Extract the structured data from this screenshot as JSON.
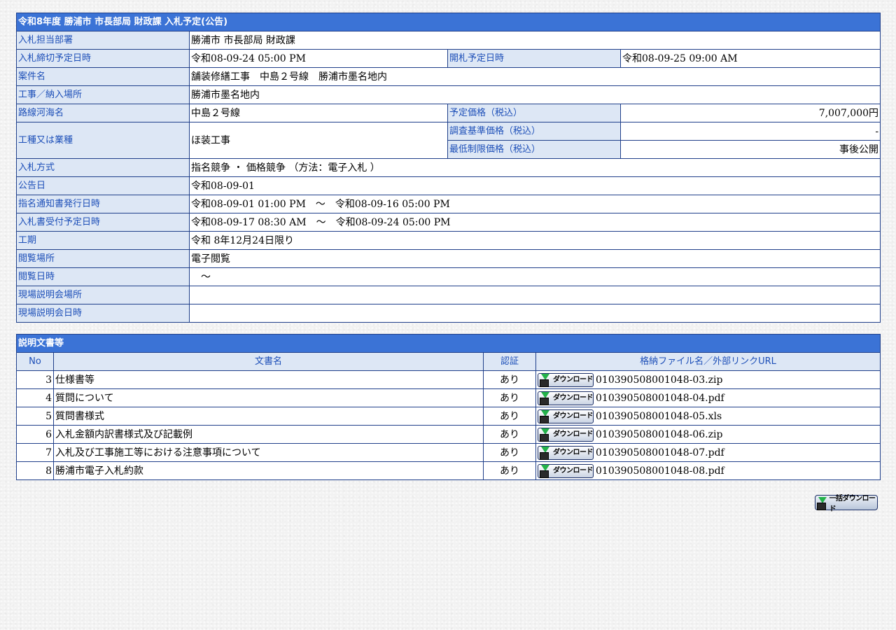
{
  "notice": {
    "title": "令和8年度 勝浦市 市長部局 財政課 入札予定(公告)",
    "rows": {
      "dept": {
        "label": "入札担当部署",
        "value": "勝浦市 市長部局 財政課"
      },
      "deadline": {
        "label": "入札締切予定日時",
        "value": "令和08-09-24 05:00 PM"
      },
      "opening": {
        "label": "開札予定日時",
        "value": "令和08-09-25 09:00 AM"
      },
      "case_name": {
        "label": "案件名",
        "value": "舗装修繕工事　中島２号線　勝浦市墨名地内"
      },
      "place": {
        "label": "工事／納入場所",
        "value": "勝浦市墨名地内"
      },
      "route": {
        "label": "路線河海名",
        "value": "中島２号線"
      },
      "planned_price": {
        "label": "予定価格（税込）",
        "value": "7,007,000円"
      },
      "category": {
        "label": "工種又は業種",
        "value": "ほ装工事"
      },
      "survey_price": {
        "label": "調査基準価格（税込）",
        "value": "-"
      },
      "min_price": {
        "label": "最低制限価格（税込）",
        "value": "事後公開"
      },
      "method": {
        "label": "入札方式",
        "value": "指名競争 ・ 価格競争 （方法：電子入札 ）"
      },
      "notice_date": {
        "label": "公告日",
        "value": "令和08-09-01"
      },
      "nomination": {
        "label": "指名通知書発行日時",
        "value": "令和08-09-01 01:00 PM　～　令和08-09-16 05:00 PM"
      },
      "acceptance": {
        "label": "入札書受付予定日時",
        "value": "令和08-09-17 08:30 AM　～　令和08-09-24 05:00 PM"
      },
      "period": {
        "label": "工期",
        "value": "令和 8年12月24日限り"
      },
      "view_place": {
        "label": "閲覧場所",
        "value": "電子閲覧"
      },
      "view_date": {
        "label": "閲覧日時",
        "value": "　～"
      },
      "briefing_place": {
        "label": "現場説明会場所",
        "value": ""
      },
      "briefing_date": {
        "label": "現場説明会日時",
        "value": ""
      }
    }
  },
  "documents": {
    "title": "説明文書等",
    "headers": {
      "no": "No",
      "name": "文書名",
      "auth": "認証",
      "file": "格納ファイル名／外部リンクURL"
    },
    "download_label": "ダウンロード",
    "items": [
      {
        "no": "3",
        "name": "仕様書等",
        "auth": "あり",
        "file": "010390508001048-03.zip"
      },
      {
        "no": "4",
        "name": "質問について",
        "auth": "あり",
        "file": "010390508001048-04.pdf"
      },
      {
        "no": "5",
        "name": "質問書様式",
        "auth": "あり",
        "file": "010390508001048-05.xls"
      },
      {
        "no": "6",
        "name": "入札金額内訳書様式及び記載例",
        "auth": "あり",
        "file": "010390508001048-06.zip"
      },
      {
        "no": "7",
        "name": "入札及び工事施工等における注意事項について",
        "auth": "あり",
        "file": "010390508001048-07.pdf"
      },
      {
        "no": "8",
        "name": "勝浦市電子入札約款",
        "auth": "あり",
        "file": "010390508001048-08.pdf"
      }
    ],
    "bulk_download_label": "一括ダウンロード"
  },
  "colors": {
    "header_bg": "#3b73d6",
    "label_bg": "#dde7f5",
    "label_text": "#1d4fb8",
    "border": "#1f3f8a"
  },
  "icons": {
    "download": "download-disk-icon"
  }
}
